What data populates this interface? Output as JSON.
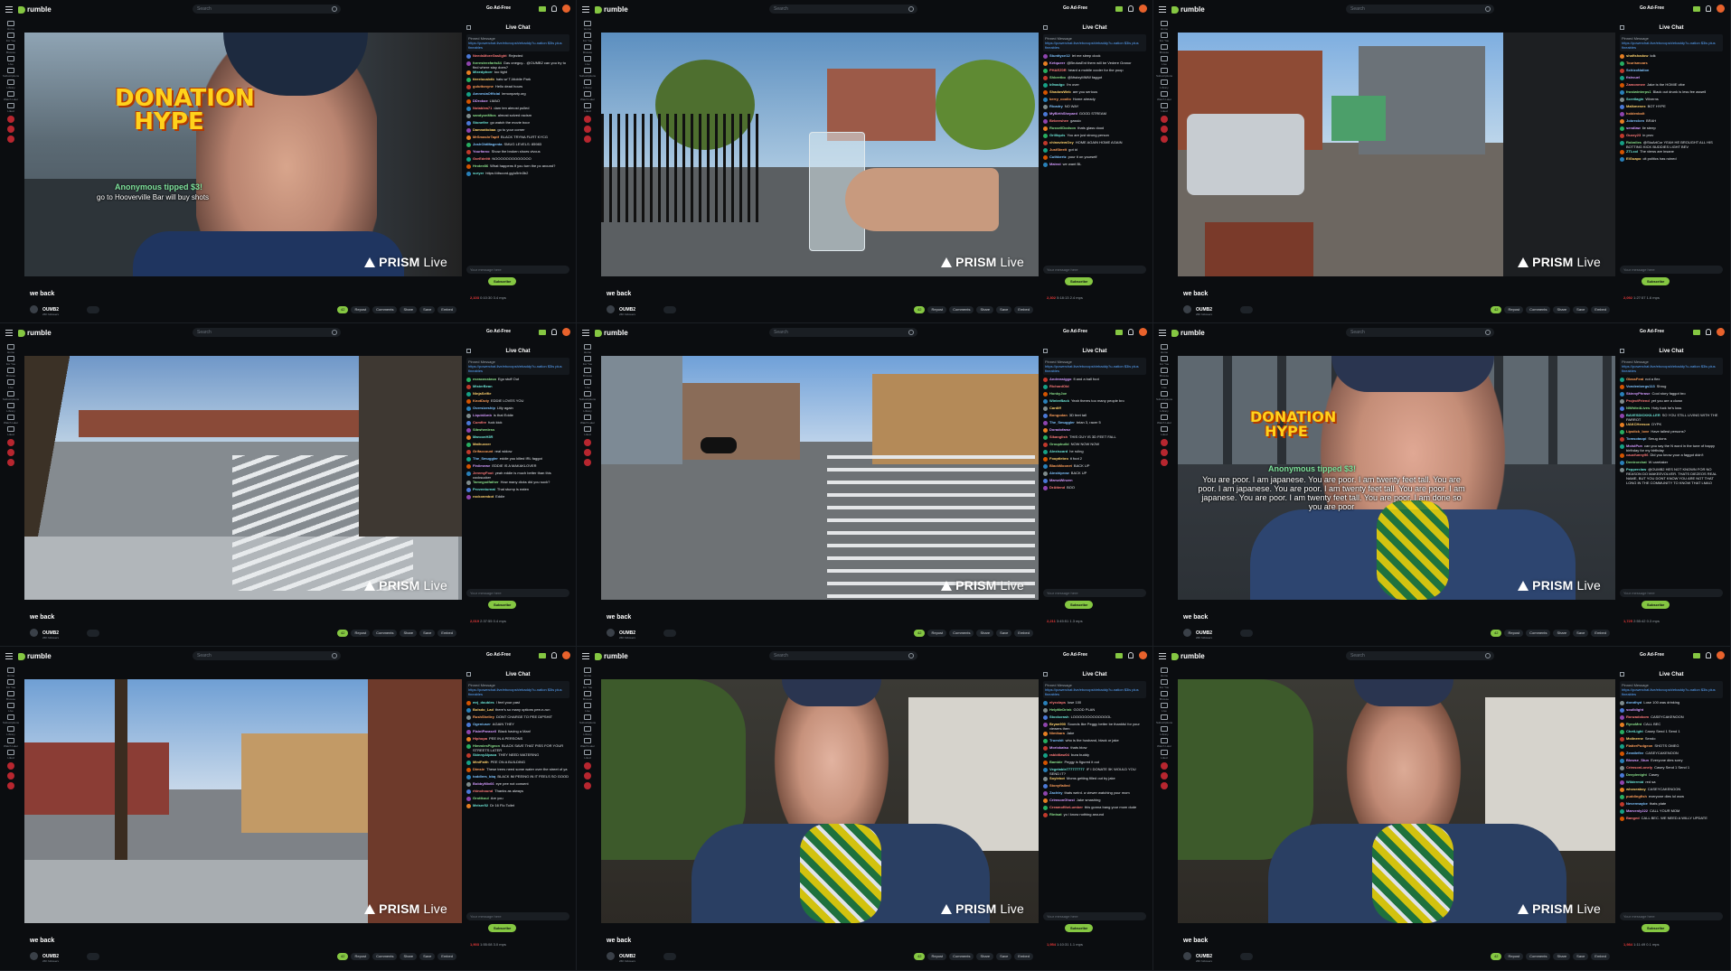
{
  "app": {
    "logo_text": "rumble",
    "search_placeholder": "Search",
    "go_ad_free": "Go Ad-Free",
    "icons": [
      "menu-icon",
      "rumble-logo-icon",
      "search-icon",
      "upload-icon",
      "bell-icon",
      "avatar-icon"
    ],
    "brand_color": "#85c742",
    "live_color": "#ea3a3a"
  },
  "nav": [
    "Home",
    "For You",
    "Browse",
    "Live",
    "Subscriptions",
    "Library",
    "Watch Later",
    "Liked"
  ],
  "video_title": "we back",
  "channel": {
    "name": "OUMB2",
    "subs": "26K followers"
  },
  "chat": {
    "header": "Live Chat",
    "pinned_title": "Pinned Message",
    "pinned_text": "https://powerchat.live/ebcvopsh/ebaddy?u-nation $3is plus fineables",
    "input_placeholder": "Your message here",
    "subscribe": "Subscribe"
  },
  "actions": [
    "42",
    "Repost",
    "Comments",
    "Share",
    "Save",
    "Embed"
  ],
  "watermark": {
    "brand": "PRISM",
    "suffix": "Live"
  },
  "panels": [
    {
      "stats_live": "2,103",
      "stats_time": "0:10:30",
      "stats_rate": "3.4 mps",
      "overlay_donation": "DONATION HYPE",
      "tip_name": "Anonymous tipped $3!",
      "tip_msg": "go to Hooverville Bar will buy shots",
      "chat": [
        [
          "NeedsMoreGaslight",
          "Rejected"
        ],
        [
          "forrestrexfarts84",
          "Gas oneguy... @OUMB2 can you try to find where stay does?"
        ],
        [
          "Mixedphorr",
          "too tight"
        ],
        [
          "ttreelocalxtb",
          "hats w/ T-Mobile Park"
        ],
        [
          "guluttonyne",
          "Hello dead hours"
        ],
        [
          "AmnesiaOfficial",
          "lemonparty.org"
        ],
        [
          "DDrokoe",
          "LMAO"
        ],
        [
          "Notablea71",
          "dam ten almost pulled"
        ],
        [
          "sandyonMtos",
          "almost solved racism"
        ],
        [
          "Stonefire",
          "go watch the movie boor"
        ],
        [
          "Damnattobaa",
          "go to your corner"
        ],
        [
          "MrSmashrTaptf",
          "BLACK TRYNA FLIRT KYCG"
        ],
        [
          "JoshObtMagenta",
          "SMUG LEVELS: 85983"
        ],
        [
          "Yourfarxo",
          "Show the broken shoes vivcus"
        ],
        [
          "GorEdelitt",
          "NOOOOOOOOOOOOO"
        ],
        [
          "Hrotee86",
          "What happens if you turn the pc around?"
        ],
        [
          "suryer",
          "https://discord.gg/u5rln3b2"
        ]
      ]
    },
    {
      "stats_live": "2,302",
      "stats_time": "5:18:13",
      "stats_rate": "2.4 mps",
      "chat": [
        [
          "Stunttyce12",
          "let me sleep clock"
        ],
        [
          "Ketqueer",
          "@BrutusEnt them will be Vedere Granor"
        ],
        [
          "PHAEZ0R",
          "heard a mobile cooler for the poop"
        ],
        [
          "Shkeetbo",
          "@MwtzyMMW faggot"
        ],
        [
          "b9nadgo",
          "I'm over"
        ],
        [
          "ShadowWeb",
          "are you serious"
        ],
        [
          "kerry_coolio",
          "Home already"
        ],
        [
          "Ricadry",
          "NO WAY"
        ],
        [
          "MyBirthShepard",
          "GOOD STREAM"
        ],
        [
          "Bebeeshee",
          "gassio"
        ],
        [
          "RussellDodson",
          "thats glass dood"
        ],
        [
          "Grilliquis",
          "You are just strong person"
        ],
        [
          "chinaviewOxy",
          "HOME AGAIN HOME AGAIN"
        ],
        [
          "JustSteeIt",
          "got id"
        ],
        [
          "Cuthbertz",
          "pour it on yourself"
        ],
        [
          "Mainst",
          "we want BL"
        ]
      ]
    },
    {
      "stats_live": "2,092",
      "stats_time": "1:27:57",
      "stats_rate": "1.6 mps",
      "chat": [
        [
          "shaftshadow",
          "kdk"
        ],
        [
          "Tourismcars",
          ""
        ],
        [
          "SchizoNation",
          ""
        ],
        [
          "fishvuel",
          ""
        ],
        [
          "Zamonmee",
          "Jake is the HOMIE vibe"
        ],
        [
          "frostwinterps1",
          "Black out drunk is less fee aswell"
        ],
        [
          "Scretlagin",
          "Wiverns"
        ],
        [
          "Malkmenex",
          "BOT HYPE"
        ],
        [
          "holdenbolt",
          ""
        ],
        [
          "Jobrecken",
          "BRAH"
        ],
        [
          "sendlaw",
          "lie steep"
        ],
        [
          "Guzzy23",
          "in prov"
        ],
        [
          "Robniles",
          "@StuArtCor YEAH HE BROUGHT ALL HIS BOTTING KICK BUDDIES LIGHT BEV"
        ],
        [
          "ZTLcol",
          "The views are insane"
        ],
        [
          "ElGuapo",
          "cit politics has ruined"
        ]
      ]
    },
    {
      "stats_live": "2,019",
      "stats_time": "2:37:55",
      "stats_rate": "0.4 mps",
      "chat": [
        [
          "eseacasstasa",
          "Ego stuff Out"
        ],
        [
          "MisterBean",
          ""
        ],
        [
          "NinjaSelfie",
          ""
        ],
        [
          "KnotDuty",
          "EDDIE LOVES YOU"
        ],
        [
          "Oversizeship",
          "Lilly again"
        ],
        [
          "LiquidAmb",
          "is that Eddie"
        ],
        [
          "Cumfire",
          "fuck kick"
        ],
        [
          "Sibwhenless",
          ""
        ],
        [
          "MaroonH3R",
          ""
        ],
        [
          "Mathuxxer",
          ""
        ],
        [
          "Grifaccount",
          "real widow"
        ],
        [
          "The_Smuggler",
          "eddie you killed IRL faggot"
        ],
        [
          "Finiimewe",
          "EDDIE IS A MAKAKLOVER"
        ],
        [
          "JeremyFoot",
          "yeah eddie is much better than this cocksucker"
        ],
        [
          "Tamegodfather",
          "How many dicks did you suck?"
        ],
        [
          "Proventurnat",
          "That stump is eaten"
        ],
        [
          "rockonmbot",
          "Eddie"
        ]
      ]
    },
    {
      "stats_live": "2,211",
      "stats_time": "3:45:51",
      "stats_rate": "1.3 mps",
      "chat": [
        [
          "Andreasiggo",
          "fl and a ball foot"
        ],
        [
          "RichardOld",
          ""
        ],
        [
          "HonkyJoe",
          ""
        ],
        [
          "WinterBack",
          "Yeah theres too many people bro"
        ],
        [
          "Cardiff",
          ""
        ],
        [
          "Bongodan",
          "3D feet tall"
        ],
        [
          "The_Smuggler",
          "brian 3, racer 5"
        ],
        [
          "Doradofamz",
          ""
        ],
        [
          "Sikanglish",
          "THIS GUY IS 3D FEET FALL"
        ],
        [
          "Groupbuild",
          "NOW NOW NOW"
        ],
        [
          "Alexiscard",
          "he ruling"
        ],
        [
          "Fooptlebro",
          "ti foot 2"
        ],
        [
          "BlackMoonet",
          "BACK UP"
        ],
        [
          "Ainshiprow",
          "BACK UP"
        ],
        [
          "MarsaWinzen",
          ""
        ],
        [
          "DrAttend",
          "BOO"
        ]
      ]
    },
    {
      "stats_live": "1,725",
      "stats_time": "2:55:42",
      "stats_rate": "0.3 mps",
      "overlay_donation": "DONATION HYPE",
      "tip_name": "Anonymous tipped $3!",
      "tip_msg": "You are poor. I am japanese. You are poor. I am twenty feet tall. You are poor. I am japanese. You are poor. I am twenty feet tall. You are poor. I am japanese. You are poor. I am twenty feet tall. You are poor. I am done so you are poor",
      "chat": [
        [
          "GlassFeat",
          "not a flex"
        ],
        [
          "Vondenbergs113",
          "Shrug"
        ],
        [
          "SkinnyPhrase",
          "Cool story faggot bro"
        ],
        [
          "ProjectFriend",
          "yet you are a clown"
        ],
        [
          "NWhite4Lives",
          "Holy fuck he's loss"
        ],
        [
          "BAVESDICKKILLER",
          "SO YOU STILL LIVING WITH THE PARROT"
        ],
        [
          "UAKCHenson",
          "DYPK"
        ],
        [
          "Lipstick_love",
          "Have tallest persons?"
        ],
        [
          "Tomsotaopi",
          "Smug dons"
        ],
        [
          "MoistPun",
          "can you say the N word in the tune of happy birthday for my birthday"
        ],
        [
          "caucfunny96",
          "Did you know your a faggot didn't"
        ],
        [
          "Dentrorchat",
          "W caretaker"
        ],
        [
          "Pepperclaw",
          "@OUMB2 HES NOT KNOWN FOR NO REASON DO MAKEEVOLVER. THATS DIEZEOS REAL NAME, BUT YOU DONT KNOW YOU ARE NOT THAT LONG IN THE COMMUNITY TO KNOW THAT LMAO"
        ]
      ]
    },
    {
      "stats_live": "1,903",
      "stats_time": "1:55:08",
      "stats_rate": "3.0 mps",
      "chat": [
        [
          "mrj_doubles",
          "I feel your past"
        ],
        [
          "Bolsdo_Lad",
          "there's so many options pee-n-run"
        ],
        [
          "RushShelley",
          "DONT CHARGE TO PEE DIPSHIT"
        ],
        [
          "Ogeniuser",
          "AGAIN THEY"
        ],
        [
          "FlaintParasell",
          "Black having a Man!"
        ],
        [
          "Hiphopa",
          "PEE IN A PERSONS"
        ],
        [
          "HimmiesPigeon",
          "BLACK SAVE THAT PISS FOR YOUR STREETS LATER"
        ],
        [
          "SkinnyAlpaca",
          "THEY NEED WATERING"
        ],
        [
          "MiniFaith",
          "PEE ON A BUILDING"
        ],
        [
          "Dimsie",
          "These trees need some water over the street of ya"
        ],
        [
          "toddlers_bbq",
          "BLACK IM PEEING IN IT FEELS SO GOOD"
        ],
        [
          "BobbyMix66",
          "eye pee not consent"
        ],
        [
          "rhinohound",
          "Thanks as always"
        ],
        [
          "Grotikoul",
          "Are you"
        ],
        [
          "Meiser52",
          "Dr 16 Flo Toilet"
        ]
      ]
    },
    {
      "stats_live": "1,954",
      "stats_time": "1:10:31",
      "stats_rate": "1.1 mps",
      "chat": [
        [
          "elyxclaps",
          "lose 100"
        ],
        [
          "HelpMeDrink",
          "GOOD PLAN"
        ],
        [
          "Stockcrash",
          "LOOOOOOOOOOOOOL"
        ],
        [
          "Bryan900",
          "Sounds like Peggy better be thankful for your viewers then"
        ],
        [
          "Nimikara",
          "Jake"
        ],
        [
          "Trueshit",
          "who is the husband, black or jake"
        ],
        [
          "Moriokatsu",
          "thats blow"
        ],
        [
          "rabbitlaw04",
          "bura buddy"
        ],
        [
          "Bamble",
          "Peggy is figured it out"
        ],
        [
          "Vegetable777777777",
          "IF I DONATE 5K WOULD YOU SEND IT?"
        ],
        [
          "Soylebot",
          "Moms getting filled out by jake"
        ],
        [
          "Stonyflailed",
          ""
        ],
        [
          "Zachtry",
          "thats weird. a viewer watching your mom"
        ],
        [
          "CrimsonGhost",
          "Jake smashing"
        ],
        [
          "CreamoftheLumber",
          "this gonna bang your mom dude"
        ],
        [
          "Rintsat",
          "yo i know nothing around"
        ]
      ]
    },
    {
      "stats_live": "1,984",
      "stats_time": "1:11:49",
      "stats_rate": "0.1 mps",
      "chat": [
        [
          "dorothyd",
          "Lose 100 was drinking"
        ],
        [
          "soulblight",
          ""
        ],
        [
          "Ronzadokom",
          "CASEYCAKENOON"
        ],
        [
          "RynoMnt",
          "CALL BEC"
        ],
        [
          "ChetLight",
          "Casey Send 1 Send 1"
        ],
        [
          "Moilnerne",
          "Sendo"
        ],
        [
          "FlatterPudgeon",
          "SHOTS OMEG"
        ],
        [
          "Zeratlefire",
          "CASEYCAKENOON"
        ],
        [
          "Blowse_Stun",
          "Everyone dies sorry"
        ],
        [
          "CrimsonLonely",
          "Casey Send 1 Send 1"
        ],
        [
          "Deeplenight",
          "Casey"
        ],
        [
          "Wildermid",
          "red sa"
        ],
        [
          "whoseaboy",
          "CASEYCAKENOON"
        ],
        [
          "puddingfish",
          "everyone dies lol wow"
        ],
        [
          "Nevermaybe",
          "thats plate"
        ],
        [
          "Marvenly222",
          "CALL YOUR MOM"
        ],
        [
          "Banged",
          "CALL BEC. WE NEED A WILLY UPDATE"
        ]
      ]
    }
  ]
}
